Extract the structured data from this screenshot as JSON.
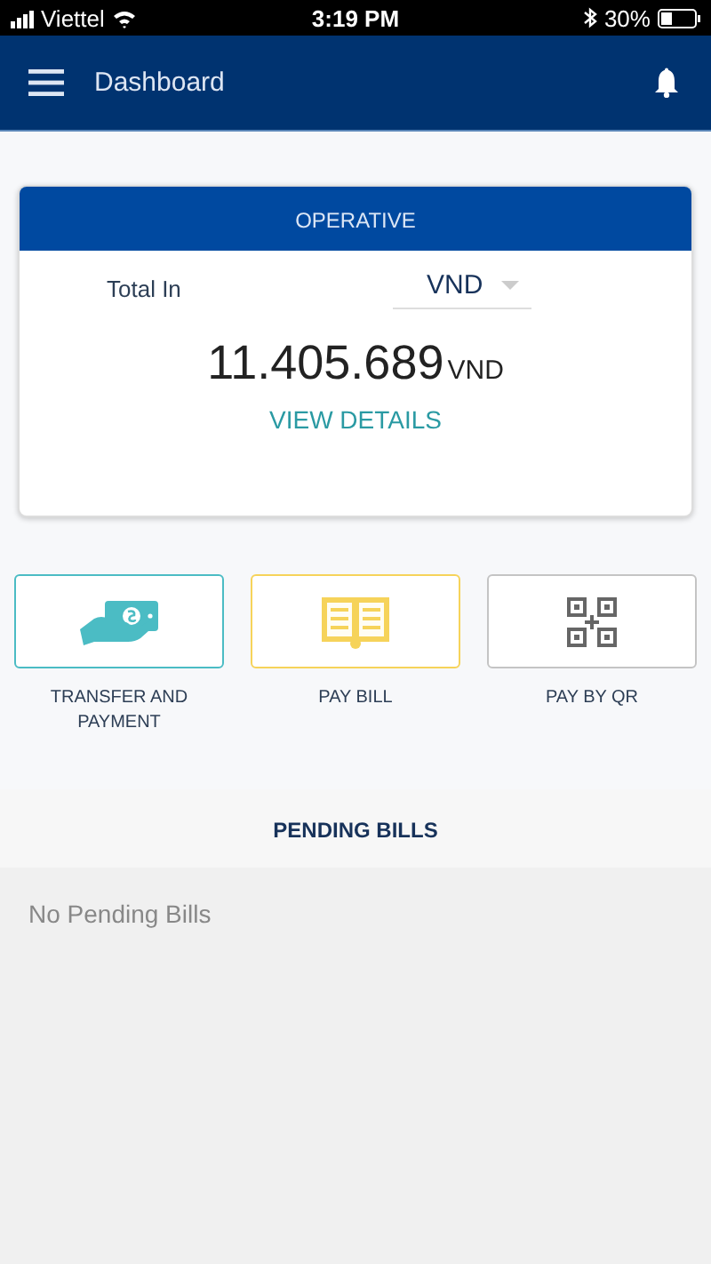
{
  "status_bar": {
    "carrier": "Viettel",
    "time": "3:19 PM",
    "battery": "30%"
  },
  "app_bar": {
    "title": "Dashboard"
  },
  "balance_card": {
    "header": "OPERATIVE",
    "label": "Total In",
    "currency_select": "VND",
    "amount": "11.405.689",
    "amount_unit": "VND",
    "link": "VIEW DETAILS"
  },
  "actions": [
    {
      "kind": "transfer",
      "label": "TRANSFER AND PAYMENT",
      "color": "#4bbcc4"
    },
    {
      "kind": "bill",
      "label": "PAY BILL",
      "color": "#f6d35a"
    },
    {
      "kind": "qr",
      "label": "PAY BY QR",
      "color": "#c4c4c4"
    }
  ],
  "pending": {
    "title": "PENDING BILLS",
    "empty_text": "No Pending Bills"
  }
}
